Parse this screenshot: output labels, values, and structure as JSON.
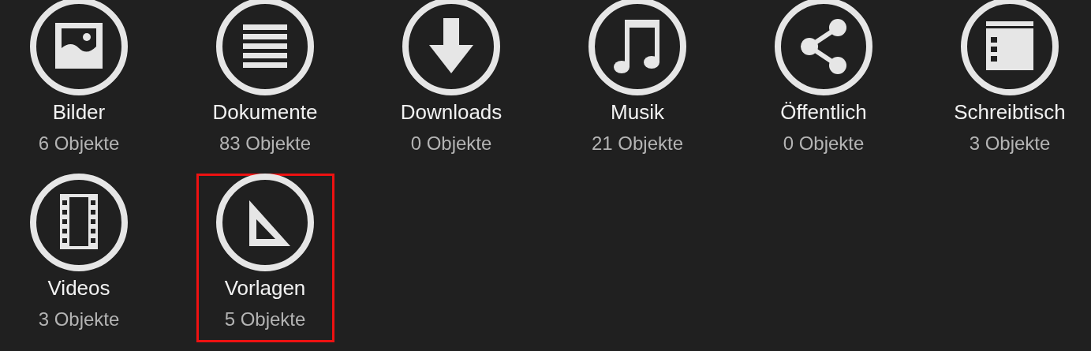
{
  "folders": [
    {
      "name": "Bilder",
      "count": "6 Objekte",
      "selected": false
    },
    {
      "name": "Dokumente",
      "count": "83 Objekte",
      "selected": false
    },
    {
      "name": "Downloads",
      "count": "0 Objekte",
      "selected": false
    },
    {
      "name": "Musik",
      "count": "21 Objekte",
      "selected": false
    },
    {
      "name": "Öffentlich",
      "count": "0 Objekte",
      "selected": false
    },
    {
      "name": "Schreibtisch",
      "count": "3 Objekte",
      "selected": false
    },
    {
      "name": "Videos",
      "count": "3 Objekte",
      "selected": false
    },
    {
      "name": "Vorlagen",
      "count": "5 Objekte",
      "selected": true
    }
  ]
}
